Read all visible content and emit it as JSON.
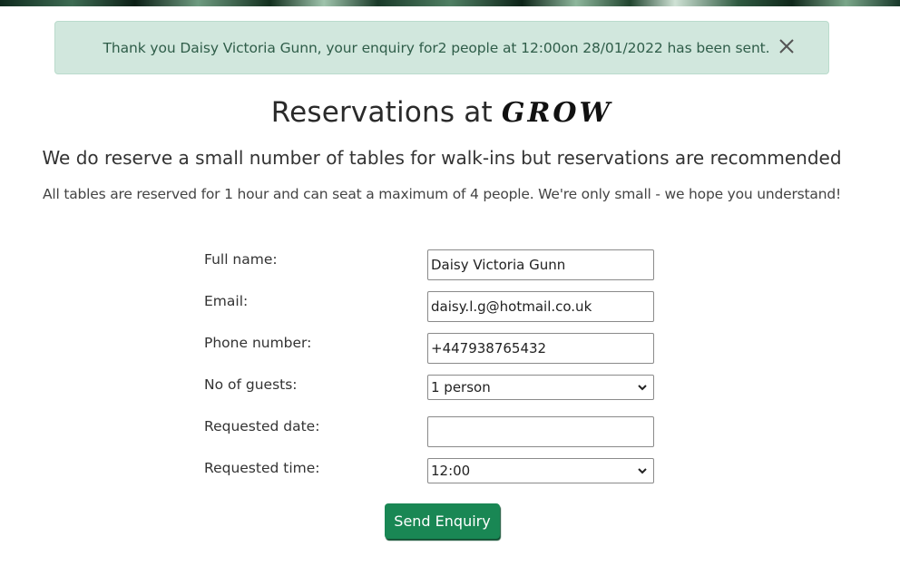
{
  "alert": {
    "message": "Thank you Daisy Victoria Gunn, your enquiry for2 people at 12:00on 28/01/2022 has been sent."
  },
  "header": {
    "title_prefix": "Reservations at ",
    "brand": "GROW",
    "subtitle": "We do reserve a small number of tables for walk-ins but reservations are recommended",
    "note": "All tables are reserved for 1 hour and can seat a maximum of 4 people. We're only small - we hope you understand!"
  },
  "form": {
    "full_name": {
      "label": "Full name:",
      "value": "Daisy Victoria Gunn"
    },
    "email": {
      "label": "Email:",
      "value": "daisy.l.g@hotmail.co.uk"
    },
    "phone": {
      "label": "Phone number:",
      "value": "+447938765432"
    },
    "guests": {
      "label": "No of guests:",
      "selected": "1 person"
    },
    "date": {
      "label": "Requested date:",
      "value": ""
    },
    "time": {
      "label": "Requested time:",
      "selected": "12:00"
    },
    "submit_label": "Send Enquiry"
  },
  "icons": {
    "close": "close-icon",
    "dropdown": "chevron-down-icon"
  },
  "colors": {
    "alert_bg": "#d1e7dd",
    "alert_text": "#2f5d49",
    "button_bg": "#198754"
  }
}
